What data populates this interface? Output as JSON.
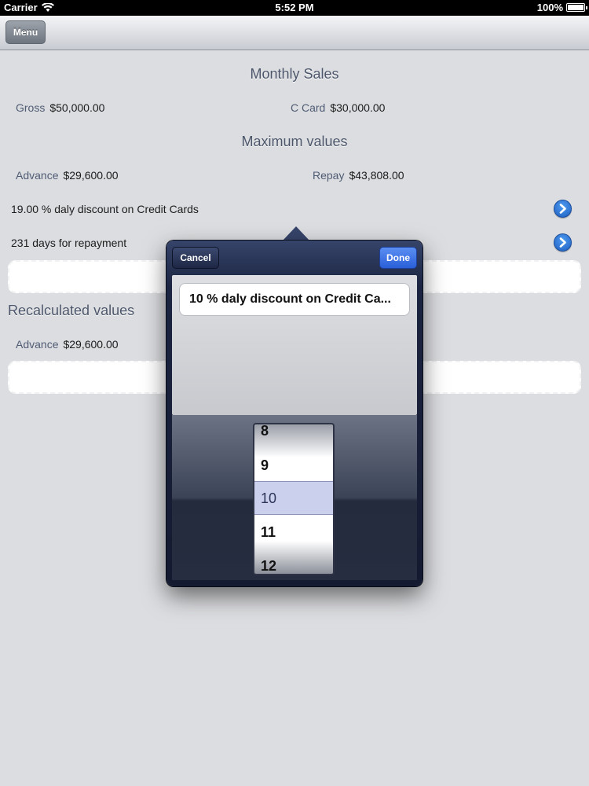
{
  "status_bar": {
    "carrier": "Carrier",
    "time": "5:52 PM",
    "battery": "100%"
  },
  "nav": {
    "menu_label": "Menu"
  },
  "monthly_sales": {
    "title": "Monthly Sales",
    "gross_label": "Gross",
    "gross_value": "$50,000.00",
    "ccard_label": "C Card",
    "ccard_value": "$30,000.00"
  },
  "maximum_values": {
    "title": "Maximum values",
    "advance_label": "Advance",
    "advance_value": "$29,600.00",
    "repay_label": "Repay",
    "repay_value": "$43,808.00"
  },
  "rows": {
    "discount_text": "19.00 % daly discount on Credit Cards",
    "days_text": "231  days for repayment"
  },
  "recalculated": {
    "title": "Recalculated values",
    "advance_label": "Advance",
    "advance_value": "$29,600.00"
  },
  "popover": {
    "cancel_label": "Cancel",
    "done_label": "Done",
    "field_value": "10 % daly discount on Credit Ca...",
    "picker_items": [
      "8",
      "9",
      "10",
      "11",
      "12"
    ],
    "picker_selected": "10"
  },
  "colors": {
    "accent": "#2a5fd9",
    "label": "#4f5c74",
    "background": "#dcdde0"
  }
}
